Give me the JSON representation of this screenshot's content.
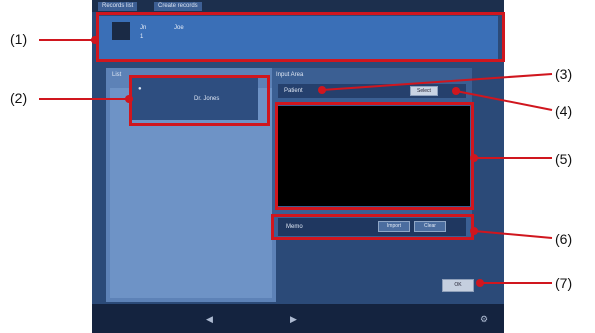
{
  "window": {
    "tabs": [
      "Records list",
      "Create records"
    ]
  },
  "top_bar": {
    "label_a": "Jn",
    "label_b": "Joe",
    "label_c": "1"
  },
  "left_panel": {
    "title": "List",
    "user_label": "Dr. Jones"
  },
  "right_panel": {
    "title": "Input Area",
    "field_label": "Patient",
    "field_button": "Select",
    "row6_label": "Memo",
    "row6_btn1": "Import",
    "row6_btn2": "Clear"
  },
  "footer": {
    "ok_label": "OK"
  },
  "callouts": [
    "(1)",
    "(2)",
    "(3)",
    "(4)",
    "(5)",
    "(6)",
    "(7)"
  ],
  "colors": {
    "highlight": "#d0161e",
    "screen_bg": "#2b4a78",
    "top_bar": "#3a6fb7"
  }
}
